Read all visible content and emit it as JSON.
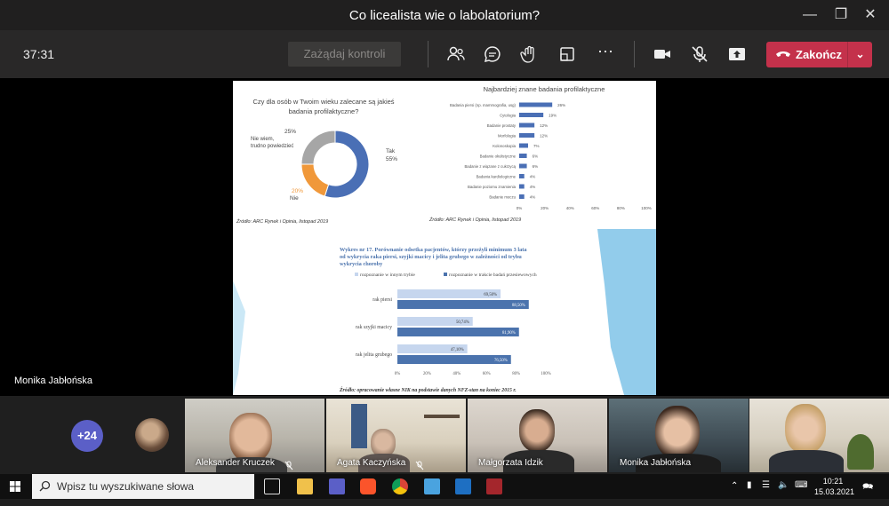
{
  "window": {
    "title": "Co licealista wie o labolatorium?"
  },
  "toolbar": {
    "timer": "37:31",
    "request_control": "Zażądaj kontroli",
    "end_label": "Zakończ"
  },
  "stage": {
    "presenter_name": "Monika Jabłońska"
  },
  "slide": {
    "donut": {
      "question": "Czy dla osób w Twoim wieku zalecane są jakieś badania profilaktyczne?",
      "segments": [
        {
          "label": "Tak",
          "value": 55,
          "display": "55%",
          "color": "#4a6fb5"
        },
        {
          "label": "Nie",
          "value": 20,
          "display": "20%",
          "color": "#f0983a"
        },
        {
          "label": "Nie wiem, trudno powiedzieć",
          "value": 25,
          "display": "25%",
          "color": "#a6a6a6"
        }
      ],
      "source": "Źródło: ARC Rynek i Opinia, listopad 2019"
    },
    "hbar": {
      "title": "Najbardziej znane badania profilaktyczne",
      "items": [
        {
          "label": "Badania piersi (np. mammografia, usg)",
          "value": 26,
          "display": "26%"
        },
        {
          "label": "Cytologia",
          "value": 19,
          "display": "19%"
        },
        {
          "label": "Badanie prostaty",
          "value": 12,
          "display": "12%"
        },
        {
          "label": "Morfologia",
          "value": 12,
          "display": "12%"
        },
        {
          "label": "Kolonoskopia",
          "value": 7,
          "display": "7%"
        },
        {
          "label": "Badanie okulistyczne",
          "value": 6,
          "display": "6%"
        },
        {
          "label": "Badanie z wiązane z cukrzycą",
          "value": 6,
          "display": "6%"
        },
        {
          "label": "Badania kardiologiczne",
          "value": 4,
          "display": "4%"
        },
        {
          "label": "Badanie poziomu znamienia",
          "value": 4,
          "display": "4%"
        },
        {
          "label": "Badanie moczu",
          "value": 4,
          "display": "4%"
        }
      ],
      "ticks": [
        "0%",
        "20%",
        "40%",
        "60%",
        "80%",
        "100%"
      ],
      "source": "Źródło: ARC Rynek i Opinia, listopad 2019"
    },
    "wykres": {
      "title": "Wykres nr 17. Porównanie odsetka pacjentów, którzy przeżyli minimum 3 lata od wykrycia raka piersi, szyjki macicy i jelita grubego w zależności od trybu wykrycia choroby",
      "legend": [
        "rozpoznanie w innym trybie",
        "rozpoznanie w trakcie badań przesiewowych"
      ],
      "groups": [
        {
          "label": "rak piersi",
          "a": 69.5,
          "a_text": "69,50%",
          "b": 88.5,
          "b_text": "88,50%"
        },
        {
          "label": "rak szyjki macicy",
          "a": 50.74,
          "a_text": "50,74%",
          "b": 81.9,
          "b_text": "81,90%"
        },
        {
          "label": "rak jelita grubego",
          "a": 47.1,
          "a_text": "47,10%",
          "b": 76.5,
          "b_text": "76,50%"
        }
      ],
      "ticks": [
        "0%",
        "20%",
        "40%",
        "60%",
        "80%",
        "100%"
      ],
      "source": "Źródło: opracowanie własne NIK na podstawie danych NFZ-stan na koniec 2015 r.",
      "colors": {
        "a": "#c6d6ee",
        "b": "#4b73ad"
      }
    }
  },
  "participants": {
    "more": "+24",
    "tiles": [
      {
        "name": "Aleksander Kruczek"
      },
      {
        "name": "Agata Kaczyńska"
      },
      {
        "name": "Małgorzata Idzik"
      },
      {
        "name": "Monika Jabłońska"
      },
      {
        "name": ""
      }
    ]
  },
  "taskbar": {
    "search_placeholder": "Wpisz tu wyszukiwane słowa",
    "time": "10:21",
    "date": "15.03.2021"
  }
}
